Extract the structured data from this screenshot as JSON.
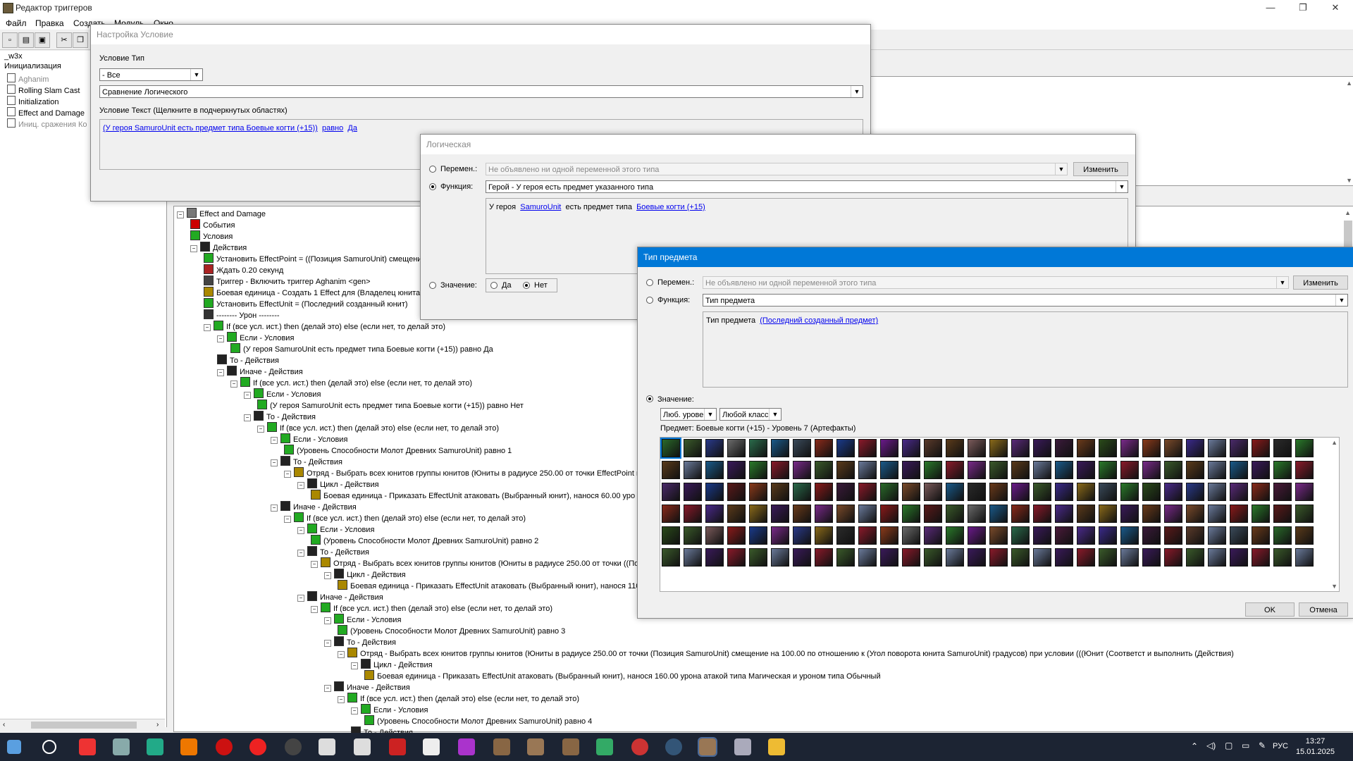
{
  "window": {
    "title": "Редактор триггеров",
    "minimize": "—",
    "maximize": "❐",
    "close": "✕"
  },
  "menu": [
    "Файл",
    "Правка",
    "Создать",
    "Модуль",
    "Окно"
  ],
  "left_tree": {
    "root": "_w3x",
    "items": [
      "Инициализация",
      "Aghanim",
      "Rolling Slam Cast",
      "Initialization",
      "Effect and Damage",
      "Иниц. сражения Ко"
    ]
  },
  "condition_dialog": {
    "title": "Настройка Условие",
    "type_label": "Условие Тип",
    "type_value": "- Все",
    "func_value": "Сравнение Логического",
    "text_label": "Условие Текст (Щелкните в подчеркнутых областях)",
    "text_link1": "(У героя SamuroUnit есть предмет типа Боевые когти (+15))",
    "text_link2": "равно",
    "text_link3": "Да"
  },
  "logical_dialog": {
    "title": "Логическая",
    "var_label": "Перемен.:",
    "var_value": "Не объявлено ни одной переменной этого типа",
    "change_button": "Изменить",
    "func_label": "Функция:",
    "func_value": "Герой - У героя есть предмет указанного типа",
    "text_prefix": "У героя",
    "text_link1": "SamuroUnit",
    "text_mid": "есть предмет типа",
    "text_link2": "Боевые когти (+15)",
    "value_label": "Значение:",
    "yes": "Да",
    "no": "Нет"
  },
  "item_dialog": {
    "title": "Тип предмета",
    "var_label": "Перемен.:",
    "var_value": "Не объявлено ни одной переменной этого типа",
    "change_button": "Изменить",
    "func_label": "Функция:",
    "func_value": "Тип предмета",
    "text_prefix": "Тип предмета",
    "text_link": "(Последний созданный предмет)",
    "value_label": "Значение:",
    "level_filter": "Люб. урове",
    "class_filter": "Любой класс",
    "item_info": "Предмет: Боевые когти (+15) - Уровень 7 (Артефакты)",
    "ok": "OK",
    "cancel": "Отмена",
    "icon_colors": [
      "#2a6a2a",
      "#4a2a8a",
      "#8a3a1a",
      "#3a5a2a",
      "#5a3a2a",
      "#7a4a2a",
      "#2a3a8a",
      "#5a3a1a",
      "#3a2a8a",
      "#6a6a6a",
      "#7a5a5a",
      "#6a7a9a",
      "#2a6a4a",
      "#8a6a1a",
      "#4a2a6a",
      "#1a5a8a",
      "#5a2a7a",
      "#8a1a1a",
      "#3a4a5a",
      "#3a1a5a",
      "#2a2a2a",
      "#8a2a1a",
      "#3a1a3a",
      "#2a7a2a",
      "#1a3a8a",
      "#6a3a1a",
      "#4a1a3a",
      "#8a1a2a",
      "#2a4a1a",
      "#5a1a1a",
      "#6a1a8a",
      "#7a2a8a"
    ]
  },
  "tree": [
    {
      "d": 0,
      "t": "Effect and Damage",
      "c": "#777"
    },
    {
      "d": 1,
      "t": "События",
      "c": "#c00"
    },
    {
      "d": 1,
      "t": "Условия",
      "c": "#2a2"
    },
    {
      "d": 1,
      "t": "Действия",
      "c": "#222"
    },
    {
      "d": 2,
      "t": "Установить EffectPoint = ((Позиция SamuroUnit) смещение",
      "c": "#2a2"
    },
    {
      "d": 2,
      "t": "Ждать 0.20 секунд",
      "c": "#a22"
    },
    {
      "d": 2,
      "t": "Триггер - Включить триггер Aghanim <gen>",
      "c": "#444"
    },
    {
      "d": 2,
      "t": "Боевая единица - Создать 1 Effect для (Владелец юнита S",
      "c": "#a80"
    },
    {
      "d": 2,
      "t": "Установить EffectUnit = (Последний созданный юнит)",
      "c": "#2a2"
    },
    {
      "d": 2,
      "t": "-------- Урон --------",
      "c": "#333"
    },
    {
      "d": 2,
      "t": "If (все усл. ист.) then (делай это) else (если нет, то делай это)",
      "c": "#2a2"
    },
    {
      "d": 3,
      "t": "Если - Условия",
      "c": "#2a2"
    },
    {
      "d": 4,
      "t": "(У героя SamuroUnit есть предмет типа Боевые когти (+15)) равно Да",
      "c": "#2a2"
    },
    {
      "d": 3,
      "t": "То - Действия",
      "c": "#222"
    },
    {
      "d": 3,
      "t": "Иначе - Действия",
      "c": "#222"
    },
    {
      "d": 4,
      "t": "If (все усл. ист.) then (делай это) else (если нет, то делай это)",
      "c": "#2a2"
    },
    {
      "d": 5,
      "t": "Если - Условия",
      "c": "#2a2"
    },
    {
      "d": 6,
      "t": "(У героя SamuroUnit есть предмет типа Боевые когти (+15)) равно Нет",
      "c": "#2a2"
    },
    {
      "d": 5,
      "t": "То - Действия",
      "c": "#222"
    },
    {
      "d": 6,
      "t": "If (все усл. ист.) then (делай это) else (если нет, то делай это)",
      "c": "#2a2"
    },
    {
      "d": 7,
      "t": "Если - Условия",
      "c": "#2a2"
    },
    {
      "d": 8,
      "t": "(Уровень Способности Молот Древних  SamuroUnit) равно 1",
      "c": "#2a2"
    },
    {
      "d": 7,
      "t": "То - Действия",
      "c": "#222"
    },
    {
      "d": 8,
      "t": "Отряд - Выбрать всех юнитов группы юнитов (Юниты в радиусе 250.00 от точки EffectPoint при у",
      "c": "#a80"
    },
    {
      "d": 9,
      "t": "Цикл - Действия",
      "c": "#222"
    },
    {
      "d": 10,
      "t": "Боевая единица - Приказать EffectUnit атаковать (Выбранный юнит), нанося 60.00 уро",
      "c": "#a80"
    },
    {
      "d": 7,
      "t": "Иначе - Действия",
      "c": "#222"
    },
    {
      "d": 8,
      "t": "If (все усл. ист.) then (делай это) else (если нет, то делай это)",
      "c": "#2a2"
    },
    {
      "d": 9,
      "t": "Если - Условия",
      "c": "#2a2"
    },
    {
      "d": 10,
      "t": "(Уровень Способности Молот Древних  SamuroUnit) равно 2",
      "c": "#2a2"
    },
    {
      "d": 9,
      "t": "То - Действия",
      "c": "#222"
    },
    {
      "d": 10,
      "t": "Отряд - Выбрать всех юнитов группы юнитов (Юниты в радиусе 250.00 от точки ((Позици",
      "c": "#a80"
    },
    {
      "d": 11,
      "t": "Цикл - Действия",
      "c": "#222"
    },
    {
      "d": 12,
      "t": "Боевая единица - Приказать EffectUnit атаковать (Выбранный юнит), нанося 110",
      "c": "#a80"
    },
    {
      "d": 9,
      "t": "Иначе - Действия",
      "c": "#222"
    },
    {
      "d": 10,
      "t": "If (все усл. ист.) then (делай это) else (если нет, то делай это)",
      "c": "#2a2"
    },
    {
      "d": 11,
      "t": "Если - Условия",
      "c": "#2a2"
    },
    {
      "d": 12,
      "t": "(Уровень Способности Молот Древних  SamuroUnit) равно 3",
      "c": "#2a2"
    },
    {
      "d": 11,
      "t": "То - Действия",
      "c": "#222"
    },
    {
      "d": 12,
      "t": "Отряд - Выбрать всех юнитов группы юнитов (Юниты в радиусе 250.00 от точки (Позиция SamuroUnit) смещение на 100.00 по отношению к (Угол поворота юнита SamuroUnit) градусов) при условии (((Юнит (Соответст и выполнить (Действия)",
      "c": "#a80"
    },
    {
      "d": 13,
      "t": "Цикл - Действия",
      "c": "#222"
    },
    {
      "d": 14,
      "t": "Боевая единица - Приказать EffectUnit атаковать (Выбранный юнит), нанося 160.00 урона атакой типа Магическая и уроном типа Обычный",
      "c": "#a80"
    },
    {
      "d": 11,
      "t": "Иначе - Действия",
      "c": "#222"
    },
    {
      "d": 12,
      "t": "If (все усл. ист.) then (делай это) else (если нет, то делай это)",
      "c": "#2a2"
    },
    {
      "d": 13,
      "t": "Если - Условия",
      "c": "#2a2"
    },
    {
      "d": 14,
      "t": "(Уровень Способности Молот Древних  SamuroUnit) равно 4",
      "c": "#2a2"
    },
    {
      "d": 13,
      "t": "То - Действия",
      "c": "#222"
    }
  ],
  "taskbar": {
    "lang": "РУС",
    "time": "13:27",
    "date": "15.01.2025"
  }
}
